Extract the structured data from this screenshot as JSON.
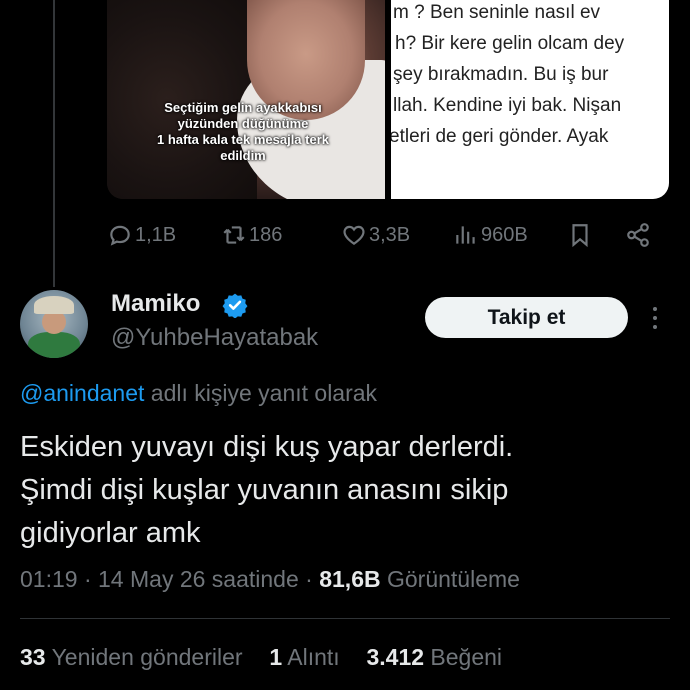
{
  "media": {
    "caption_lines": [
      "Seçtiğim gelin ayakkabısı",
      "yüzünden düğünüme",
      "1 hafta kala tek mesajla terk",
      "edildim"
    ],
    "chat_lines": [
      "m ?  Ben seninle nasıl ev",
      "h? Bir kere gelin olcam dey",
      "şey bırakmadın. Bu iş bur",
      "llah. Kendine iyi bak. Nişan",
      "etleri de geri gönder. Ayak"
    ]
  },
  "action_bar": {
    "reply_count": "1,1B",
    "retweet_count": "186",
    "like_count": "3,3B",
    "view_count": "960B"
  },
  "author": {
    "name": "Mamiko",
    "handle": "@YuhbeHayatabak",
    "verified_color": "#1d9bf0"
  },
  "follow_button": "Takip et",
  "reply_context": {
    "mention": "@anindanet",
    "suffix": "adlı kişiye yanıt olarak"
  },
  "tweet": {
    "lines": [
      "Eskiden yuvayı dişi kuş yapar derlerdi.",
      "Şimdi dişi kuşlar yuvanın anasını sikip",
      "gidiyorlar amk"
    ]
  },
  "meta": {
    "time": "01:19",
    "date": "14 May 26 saatinde",
    "views": "81,6B",
    "views_label": "Görüntüleme"
  },
  "stats": {
    "retweets": "33",
    "retweets_label": "Yeniden gönderiler",
    "quotes": "1",
    "quotes_label": "Alıntı",
    "likes": "3.412",
    "likes_label": "Beğeni"
  },
  "colors": {
    "background": "#000000",
    "text": "#e7e9ea",
    "secondary": "#71767b",
    "link": "#1d9bf0"
  }
}
